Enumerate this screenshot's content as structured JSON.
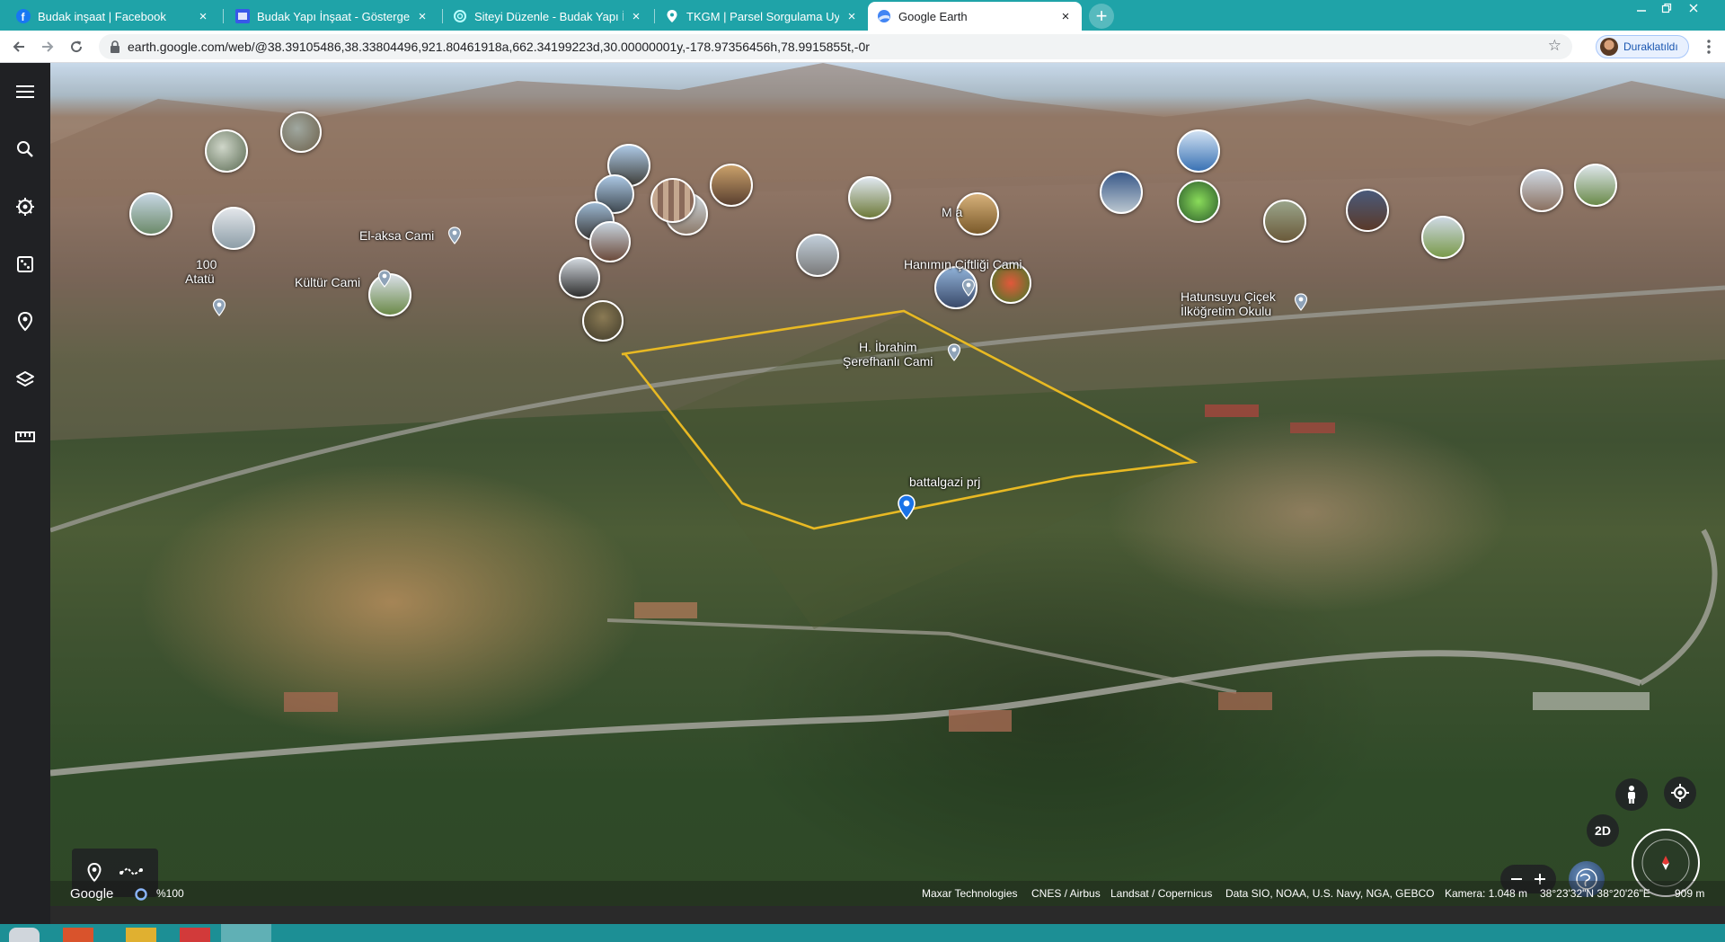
{
  "browser": {
    "tabs": [
      {
        "title": "Budak inşaat | Facebook",
        "favicon": "facebook-icon",
        "active": false
      },
      {
        "title": "Budak Yapı İnşaat - Gösterge tab",
        "favicon": "wordpress-icon",
        "active": false
      },
      {
        "title": "Siteyi Düzenle - Budak Yapı İnşaa",
        "favicon": "edit-swirl-icon",
        "active": false
      },
      {
        "title": "TKGM | Parsel Sorgulama Uygula",
        "favicon": "map-pin-icon",
        "active": false
      },
      {
        "title": "Google Earth",
        "favicon": "google-earth-icon",
        "active": true
      }
    ],
    "close_glyph": "×",
    "new_tab_glyph": "+",
    "url": "earth.google.com/web/@38.39105486,38.33804496,921.80461918a,662.34199223d,30.00000001y,-178.97356456h,78.9915855t,-0r",
    "profile_label": "Duraklatıldı",
    "accent": "#1fa3a8"
  },
  "sidebar": {
    "items": [
      {
        "name": "menu",
        "icon": "menu-icon"
      },
      {
        "name": "search",
        "icon": "search-icon"
      },
      {
        "name": "voyager",
        "icon": "voyager-wheel-icon"
      },
      {
        "name": "feeling-lucky",
        "icon": "dice-icon"
      },
      {
        "name": "projects",
        "icon": "bookmark-pin-icon"
      },
      {
        "name": "map-style",
        "icon": "layers-icon"
      },
      {
        "name": "measure",
        "icon": "ruler-icon"
      }
    ]
  },
  "map": {
    "labels": {
      "el_aksa": "El-aksa Cami",
      "kultur": "Kültür Cami",
      "yuz": "100",
      "atatu": "Atatü",
      "hanimin": "Hanımın Çiftliği Cami",
      "m_a": "M        a",
      "hatunsuyu_1": "Hatunsuyu Çiçek",
      "hatunsuyu_2": "İlköğretim Okulu",
      "ibrahim_1": "H. İbrahim",
      "ibrahim_2": "Şerefhanlı Cami",
      "placemark": "battalgazi prj"
    },
    "polygon_color": "#e8b923",
    "controls": {
      "mode_2d": "2D"
    }
  },
  "status_bar": {
    "google": "Google",
    "progress": "%100",
    "credits": [
      "Maxar Technologies",
      "CNES / Airbus",
      "Landsat / Copernicus",
      "Data SIO, NOAA, U.S. Navy, NGA, GEBCO"
    ],
    "camera": "Kamera: 1.048 m",
    "coords": "38°23'32\"N 38°20'26\"E",
    "elevation": "909 m"
  }
}
